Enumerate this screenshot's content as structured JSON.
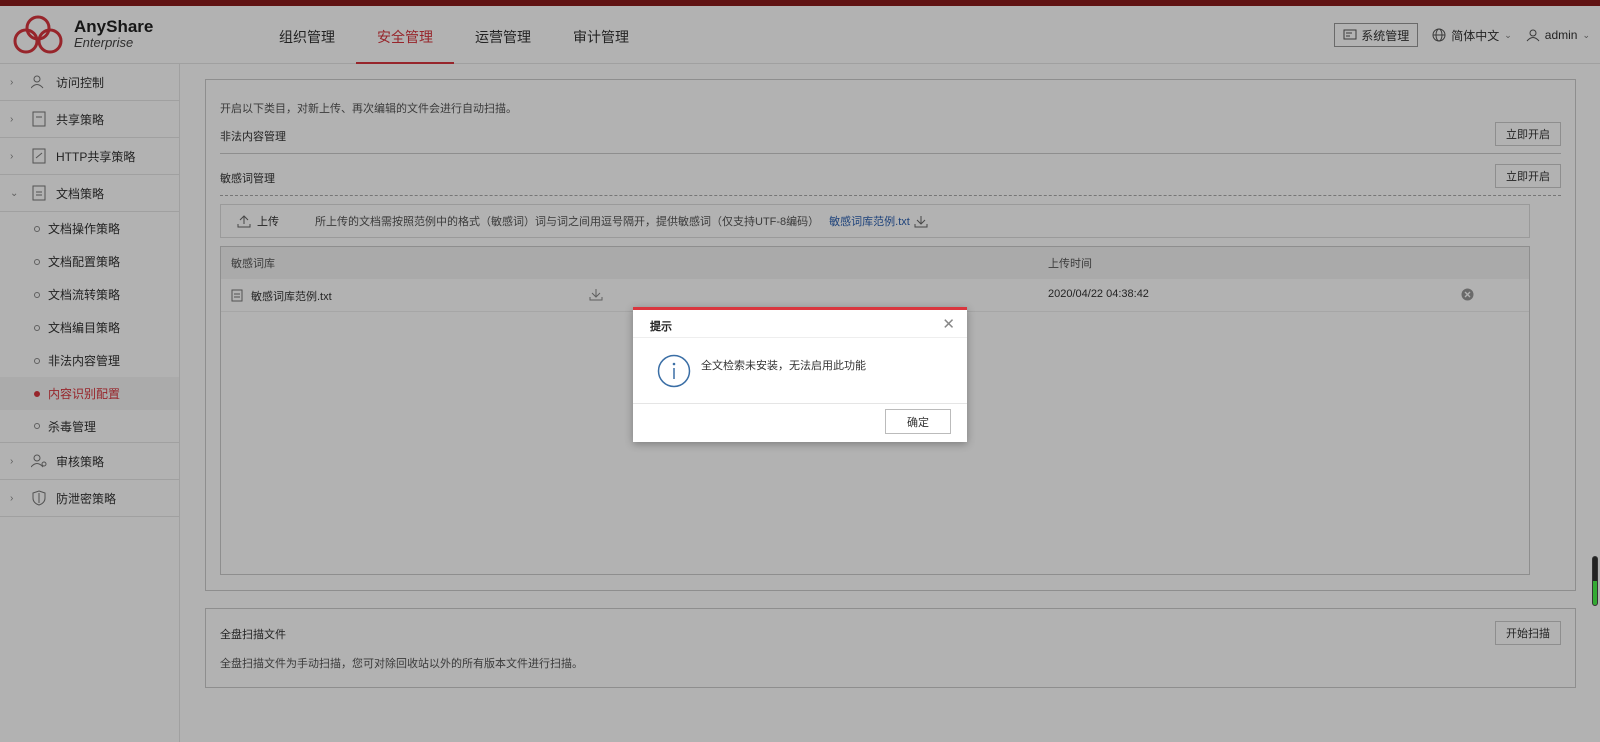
{
  "brand": {
    "name": "AnyShare",
    "edition": "Enterprise",
    "accent": "#d9363e"
  },
  "nav": {
    "items": [
      {
        "label": "组织管理"
      },
      {
        "label": "安全管理",
        "active": true
      },
      {
        "label": "运营管理"
      },
      {
        "label": "审计管理"
      }
    ]
  },
  "header_right": {
    "system_label": "系统管理",
    "language": "简体中文",
    "user": "admin"
  },
  "sidebar": {
    "groups": [
      {
        "label": "访问控制"
      },
      {
        "label": "共享策略"
      },
      {
        "label": "HTTP共享策略"
      },
      {
        "label": "文档策略",
        "expanded": true
      }
    ],
    "subitems": [
      {
        "label": "文档操作策略"
      },
      {
        "label": "文档配置策略"
      },
      {
        "label": "文档流转策略"
      },
      {
        "label": "文档编目策略"
      },
      {
        "label": "非法内容管理"
      },
      {
        "label": "内容识别配置",
        "active": true
      },
      {
        "label": "杀毒管理"
      }
    ],
    "groups_after": [
      {
        "label": "审核策略"
      },
      {
        "label": "防泄密策略"
      }
    ]
  },
  "main": {
    "intro": "开启以下类目，对新上传、再次编辑的文件会进行自动扫描。",
    "illegal_title": "非法内容管理",
    "sensitive_title": "敏感词管理",
    "open_label": "立即开启",
    "upload": {
      "label": "上传",
      "hint": "所上传的文档需按照范例中的格式（敏感词）词与词之间用逗号隔开，提供敏感词（仅支持UTF-8编码）",
      "sample_link": "敏感词库范例.txt"
    },
    "table": {
      "headers": [
        "敏感词库",
        "上传时间"
      ],
      "rows": [
        {
          "name": "敏感词库范例.txt",
          "time": "2020/04/22 04:38:42"
        }
      ]
    },
    "scan": {
      "title": "全盘扫描文件",
      "desc": "全盘扫描文件为手动扫描，您可对除回收站以外的所有版本文件进行扫描。",
      "button": "开始扫描"
    }
  },
  "dialog": {
    "title": "提示",
    "message": "全文检索未安装，无法启用此功能",
    "ok_label": "确定"
  }
}
